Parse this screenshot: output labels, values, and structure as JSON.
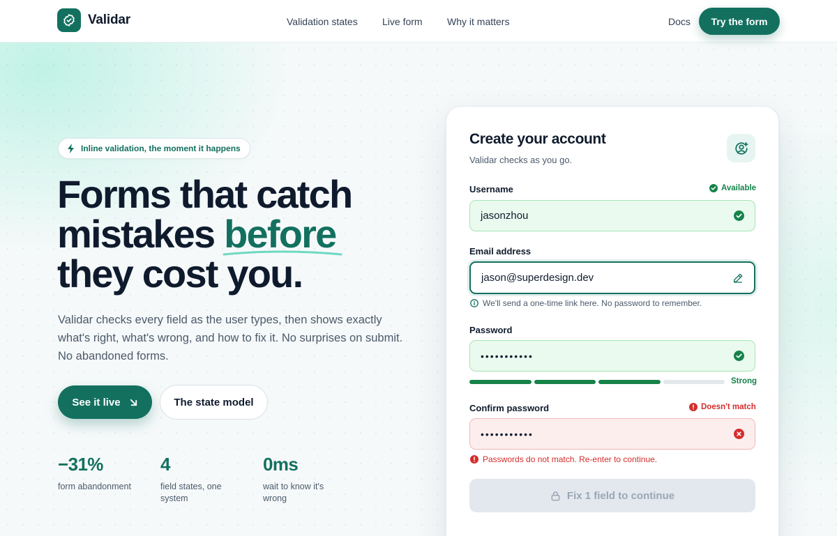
{
  "brand": {
    "name": "Validar"
  },
  "nav": {
    "links": [
      "Validation states",
      "Live form",
      "Why it matters"
    ],
    "docs": "Docs",
    "cta": "Try the form"
  },
  "hero": {
    "badge": "Inline validation, the moment it happens",
    "headline_line1": "Forms that catch",
    "headline_line2_a": "mistakes ",
    "headline_line2_accent": "before",
    "headline_line3": "they cost you.",
    "subtext": "Validar checks every field as the user types, then shows exactly what's right, what's wrong, and how to fix it. No surprises on submit. No abandoned forms.",
    "primary_button": "See it live",
    "secondary_button": "The state model",
    "stats": [
      {
        "value": "−31%",
        "label": "form abandonment"
      },
      {
        "value": "4",
        "label": "field states, one system"
      },
      {
        "value": "0ms",
        "label": "wait to know it's wrong"
      }
    ]
  },
  "form": {
    "title": "Create your account",
    "subtitle": "Validar checks as you go.",
    "username": {
      "label": "Username",
      "status": "Available",
      "value": "jasonzhou"
    },
    "email": {
      "label": "Email address",
      "value": "jason@superdesign.dev",
      "helper": "We'll send a one-time link here. No password to remember."
    },
    "password": {
      "label": "Password",
      "value": "•••••••••••",
      "strength_label": "Strong",
      "strength_level": 0.75
    },
    "confirm": {
      "label": "Confirm password",
      "status": "Doesn't match",
      "value": "•••••••••••",
      "error": "Passwords do not match. Re-enter to continue."
    },
    "submit": "Fix 1 field to continue"
  },
  "colors": {
    "brand": "#13705f",
    "success": "#16834a",
    "error": "#d42d2d",
    "ink": "#0f1b2d"
  },
  "icons": [
    "badge-check-icon",
    "bolt-icon",
    "arrow-down-right-icon",
    "user-plus-icon",
    "check-circle-icon",
    "pencil-icon",
    "info-icon",
    "alert-circle-icon",
    "x-circle-icon",
    "lock-icon"
  ]
}
